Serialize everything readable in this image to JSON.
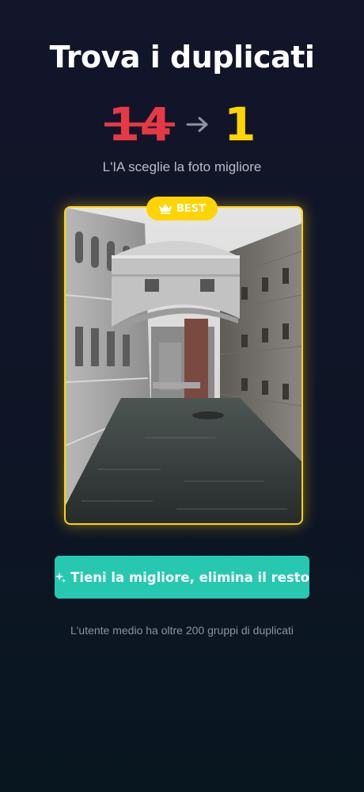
{
  "header": {
    "title": "Trova i duplicati"
  },
  "counter": {
    "from": "14",
    "to": "1",
    "arrow_icon": "arrow-right-icon",
    "from_color": "#e63946",
    "to_color": "#ffd400"
  },
  "subtitle": "L'IA sceglie la foto migliore",
  "photo": {
    "badge_label": "BEST",
    "badge_icon": "crown-icon",
    "badge_color": "#ffd400",
    "content": "canal-bridge-photo"
  },
  "cta": {
    "label": "Tieni la migliore, elimina il resto",
    "icon": "sparkle-icon",
    "color": "#27c8b0"
  },
  "footnote": "L'utente medio ha oltre 200 gruppi di duplicati"
}
